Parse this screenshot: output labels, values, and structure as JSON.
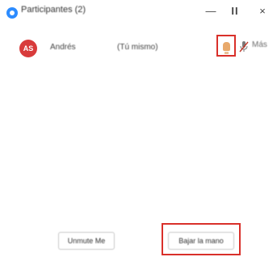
{
  "window": {
    "title": "Participantes (2)",
    "min_glyph": "—",
    "max_glyph": "II",
    "close_glyph": "×"
  },
  "participant": {
    "initials": "AS",
    "name": "Andrés",
    "role": "(Tú mismo)",
    "more_label": "Más",
    "avatar_color": "#d83b3b"
  },
  "buttons": {
    "unmute_all": "Unmute Me",
    "lower_hand": "Bajar la mano"
  },
  "colors": {
    "highlight": "#d9302a",
    "accent": "#2d8cff"
  }
}
